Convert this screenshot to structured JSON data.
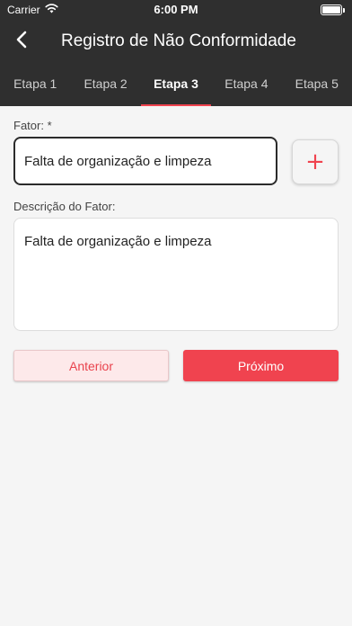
{
  "status_bar": {
    "carrier": "Carrier",
    "time": "6:00 PM"
  },
  "header": {
    "title": "Registro de Não Conformidade",
    "back_icon": "chevron-left-icon"
  },
  "tabs": [
    {
      "label": "Etapa 1",
      "active": false
    },
    {
      "label": "Etapa 2",
      "active": false
    },
    {
      "label": "Etapa 3",
      "active": true
    },
    {
      "label": "Etapa 4",
      "active": false
    },
    {
      "label": "Etapa 5",
      "active": false
    }
  ],
  "form": {
    "fator_label": "Fator: *",
    "fator_value": "Falta de organização e limpeza",
    "add_button_symbol": "+",
    "descricao_label": "Descrição do Fator:",
    "descricao_value": "Falta de organização e limpeza"
  },
  "actions": {
    "anterior_label": "Anterior",
    "proximo_label": "Próximo"
  },
  "colors": {
    "header_bg": "#2f2f2f",
    "accent": "#f0434f",
    "secondary_button_bg": "#fde9ea",
    "page_bg": "#f5f5f5"
  }
}
